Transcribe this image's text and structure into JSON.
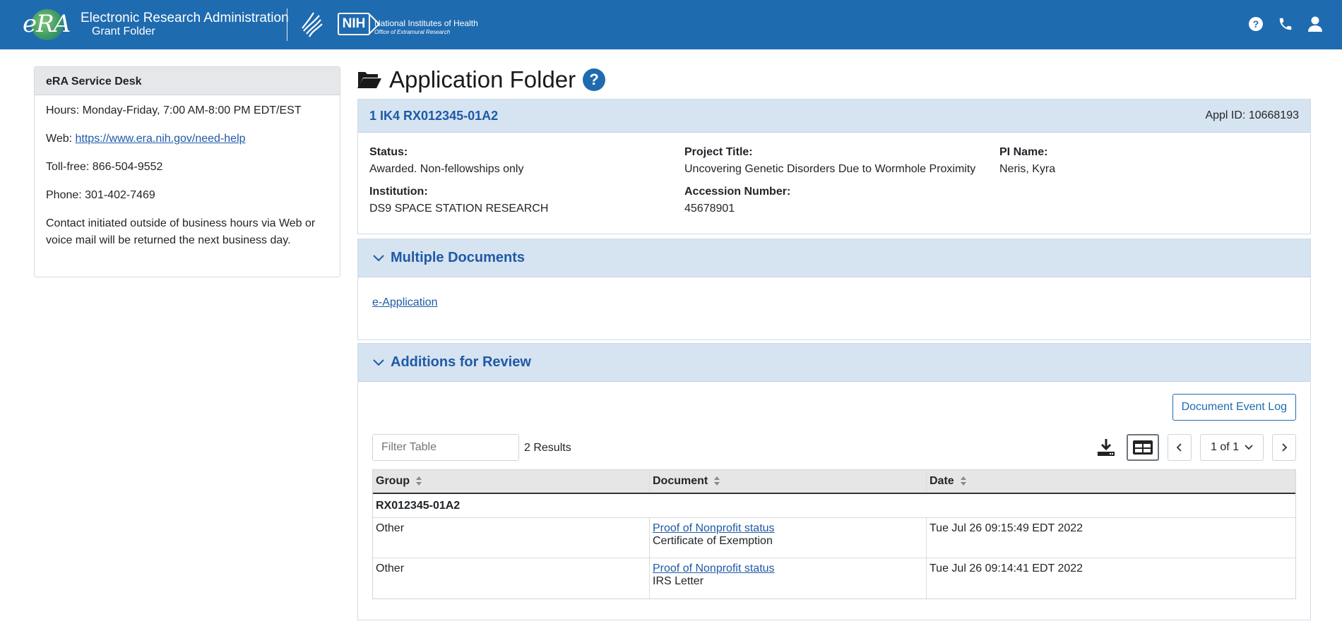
{
  "header": {
    "logo_text": "eRA",
    "app_title": "Electronic Research Administration",
    "app_subtitle": "Grant Folder",
    "nih_abbrev": "NIH",
    "nih_name": "National Institutes of Health",
    "nih_office": "Office of Extramural Research",
    "brand_color": "#1f6bb0",
    "icons": [
      "help-icon",
      "phone-icon",
      "user-icon"
    ]
  },
  "sidebar": {
    "title": "eRA Service Desk",
    "hours": "Hours: Monday-Friday, 7:00 AM-8:00 PM EDT/EST",
    "web_label": "Web: ",
    "web_link": "https://www.era.nih.gov/need-help",
    "tollfree": "Toll-free: 866-504-9552",
    "phone": "Phone: 301-402-7469",
    "note": "Contact initiated outside of business hours via Web or voice mail will be returned the next business day."
  },
  "page": {
    "title": "Application Folder",
    "help_glyph": "?"
  },
  "application": {
    "grant_number": "1 IK4 RX012345-01A2",
    "appl_id": "Appl ID: 10668193",
    "status_label": "Status:",
    "status_value": "Awarded. Non-fellowships only",
    "project_title_label": "Project Title:",
    "project_title_value": "Uncovering Genetic Disorders Due to Wormhole Proximity",
    "pi_label": "PI Name:",
    "pi_value": "Neris, Kyra",
    "institution_label": "Institution:",
    "institution_value": "DS9 SPACE STATION RESEARCH",
    "accession_label": "Accession Number:",
    "accession_value": "45678901"
  },
  "multiple_documents": {
    "title": "Multiple Documents",
    "link": "e-Application"
  },
  "additions": {
    "title": "Additions for Review",
    "event_log_button": "Document Event Log",
    "filter_placeholder": "Filter Table",
    "results": "2 Results",
    "pagination": "1 of 1",
    "columns": [
      "Group",
      "Document",
      "Date"
    ],
    "group_label": "RX012345-01A2",
    "rows": [
      {
        "group": "Other",
        "doc_link": "Proof of Nonprofit status",
        "doc_sub": "Certificate of Exemption",
        "date": "Tue Jul 26 09:15:49 EDT 2022"
      },
      {
        "group": "Other",
        "doc_link": "Proof of Nonprofit status",
        "doc_sub": "IRS Letter",
        "date": "Tue Jul 26 09:14:41 EDT 2022"
      }
    ]
  }
}
